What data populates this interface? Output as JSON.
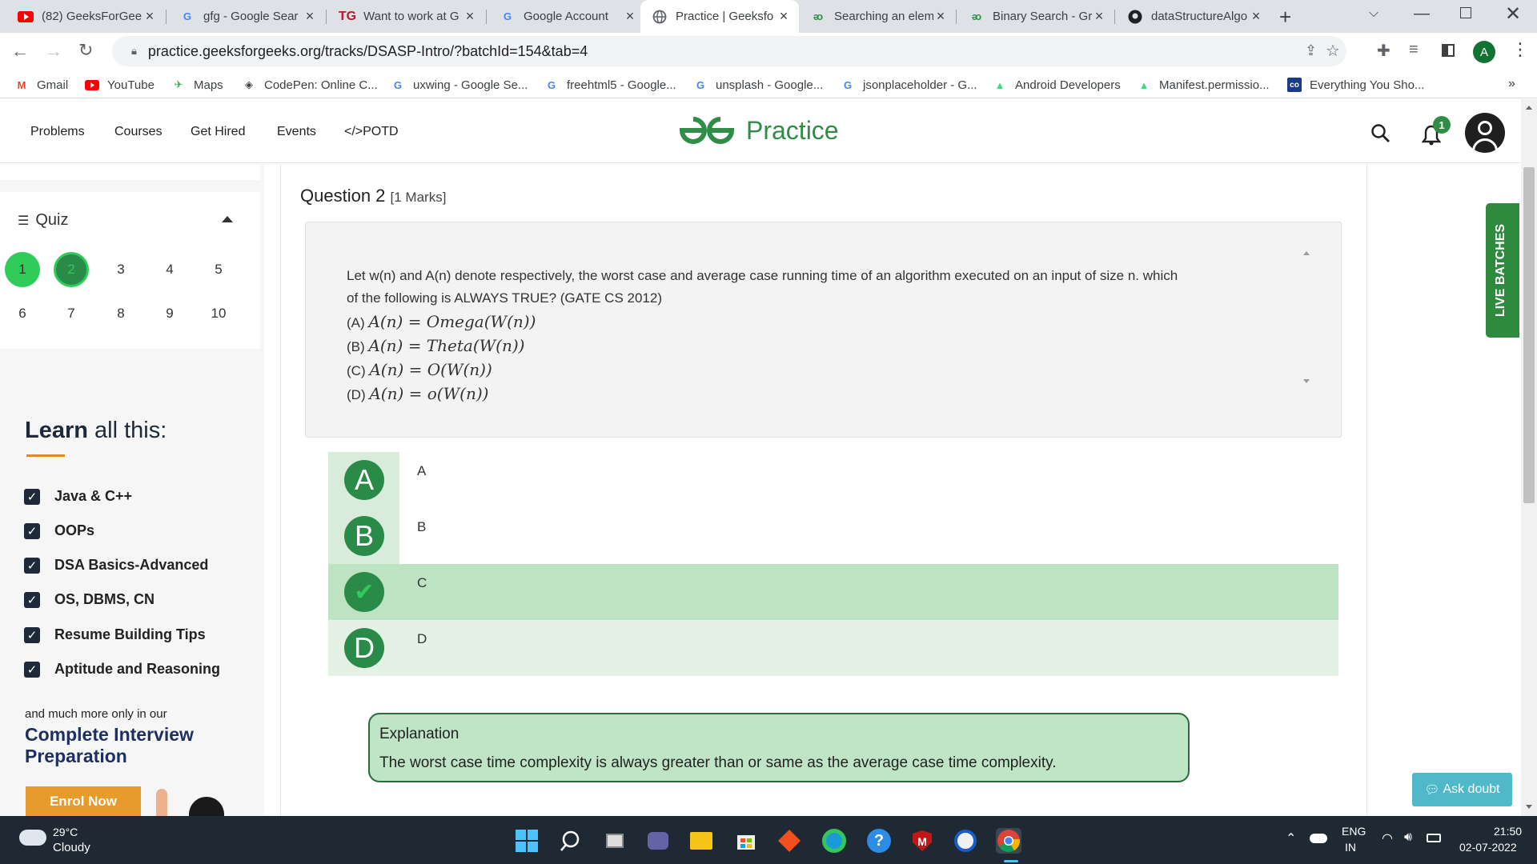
{
  "browser": {
    "tabs": [
      {
        "title": "(82) GeeksForGee",
        "icon": "youtube-icon"
      },
      {
        "title": "gfg - Google Sear",
        "icon": "google-icon"
      },
      {
        "title": "Want to work at G",
        "icon": "tg-icon"
      },
      {
        "title": "Google Account",
        "icon": "google-icon"
      },
      {
        "title": "Practice | Geeksfo",
        "icon": "gfg-globe-icon"
      },
      {
        "title": "Searching an elem",
        "icon": "gfg-icon"
      },
      {
        "title": "Binary Search - Gr",
        "icon": "gfg-icon"
      },
      {
        "title": "dataStructureAlgo",
        "icon": "github-icon"
      }
    ],
    "url": "practice.geeksforgeeks.org/tracks/DSASP-Intro/?batchId=154&tab=4",
    "profile_initial": "A",
    "bookmarks": [
      {
        "label": "Gmail",
        "icon": "gmail-icon"
      },
      {
        "label": "YouTube",
        "icon": "youtube-icon"
      },
      {
        "label": "Maps",
        "icon": "maps-icon"
      },
      {
        "label": "CodePen: Online C...",
        "icon": "codepen-icon"
      },
      {
        "label": "uxwing - Google Se...",
        "icon": "google-icon"
      },
      {
        "label": "freehtml5 - Google...",
        "icon": "google-icon"
      },
      {
        "label": "unsplash - Google...",
        "icon": "google-icon"
      },
      {
        "label": "jsonplaceholder - G...",
        "icon": "google-icon"
      },
      {
        "label": "Android Developers",
        "icon": "android-icon"
      },
      {
        "label": "Manifest.permissio...",
        "icon": "android-icon"
      },
      {
        "label": "Everything You Sho...",
        "icon": "co-icon"
      }
    ]
  },
  "site": {
    "nav": [
      "Problems",
      "Courses",
      "Get Hired",
      "Events",
      "</>POTD"
    ],
    "logo_text": "Practice",
    "notification_count": "1"
  },
  "quiz": {
    "title": "Quiz",
    "numbers": [
      "1",
      "2",
      "3",
      "4",
      "5",
      "6",
      "7",
      "8",
      "9",
      "10"
    ]
  },
  "promo": {
    "heading_a": "Learn",
    "heading_b": "all this:",
    "items": [
      "Java & C++",
      "OOPs",
      "DSA Basics-Advanced",
      "OS, DBMS, CN",
      "Resume Building Tips",
      "Aptitude and Reasoning"
    ],
    "more": "and much more only in our",
    "course_line1": "Complete Interview",
    "course_line2": "Preparation",
    "enrol": "Enrol Now"
  },
  "question": {
    "heading": "Question 2",
    "marks": "[1 Marks]",
    "text_line1": "Let w(n) and A(n) denote respectively, the worst case and average case running time of an algorithm executed on an input of size n. which",
    "text_line2": "of the following is ALWAYS TRUE? (GATE CS 2012)",
    "choices": [
      {
        "prefix": "(A)",
        "math": "A(n) = Omega(W(n))"
      },
      {
        "prefix": "(B)",
        "math": "A(n) = Theta(W(n))"
      },
      {
        "prefix": "(C)",
        "math": "A(n) = O(W(n))"
      },
      {
        "prefix": "(D)",
        "math": "A(n) = o(W(n))"
      }
    ],
    "options": [
      {
        "letter": "A",
        "label": "A",
        "state": "normal"
      },
      {
        "letter": "B",
        "label": "B",
        "state": "normal"
      },
      {
        "letter": "✔",
        "label": "C",
        "state": "correct"
      },
      {
        "letter": "D",
        "label": "D",
        "state": "normal"
      }
    ],
    "explanation_title": "Explanation",
    "explanation_text": "The worst case time complexity is always greater than or same as the average case time complexity."
  },
  "side": {
    "live_batches": "LIVE BATCHES",
    "ask_doubt": "Ask doubt"
  },
  "taskbar": {
    "temp": "29°C",
    "weather": "Cloudy",
    "lang1": "ENG",
    "lang2": "IN",
    "time": "21:50",
    "date": "02-07-2022"
  },
  "colors": {
    "gfg_green": "#2f8d46",
    "correct_bg": "#bde3c3",
    "option_bg": "#d9ecdc"
  }
}
